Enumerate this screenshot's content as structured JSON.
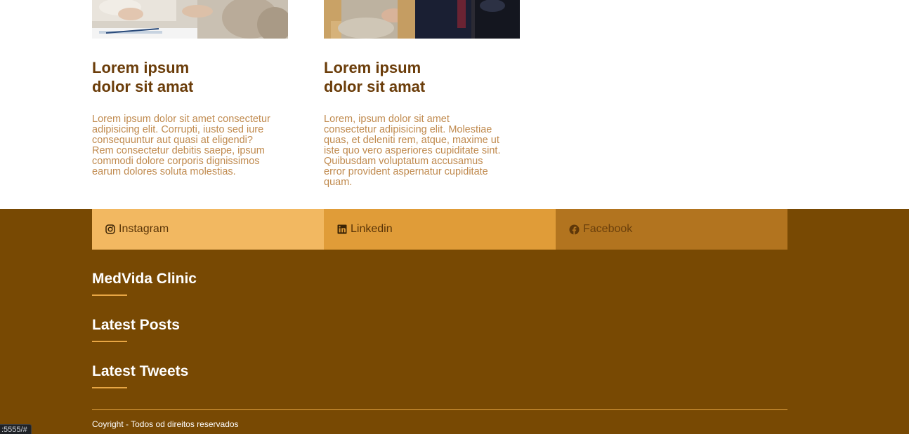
{
  "posts": [
    {
      "title_line1": "Lorem ipsum",
      "title_line2": "dolor sit amat",
      "text": "Lorem ipsum dolor sit amet consectetur adipisicing elit. Corrupti, iusto sed iure consequuntur aut quasi at eligendi? Rem consectetur debitis saepe, ipsum commodi dolore corporis dignissimos earum dolores soluta molestias."
    },
    {
      "title_line1": "Lorem ipsum",
      "title_line2": "dolor sit amat",
      "text": "Lorem, ipsum dolor sit amet consectetur adipisicing elit. Molestiae quas, et deleniti rem, atque, maxime ut iste quo vero asperiores cupiditate sint. Quibusdam voluptatum accusamus error provident aspernatur cupiditate quam."
    }
  ],
  "social": [
    {
      "label": "Instagram",
      "icon": "instagram-icon",
      "color": "#f2b861"
    },
    {
      "label": "Linkedin",
      "icon": "linkedin-icon",
      "color": "#e09c38"
    },
    {
      "label": "Facebook",
      "icon": "facebook-icon",
      "color": "#b2741f"
    }
  ],
  "footer": {
    "headings": [
      "MedVida Clinic",
      "Latest Posts",
      "Latest Tweets"
    ],
    "copyright": "Coyright - Todos od direitos reservados",
    "background": "#784903",
    "accent": "#e8a644"
  },
  "status_bar": {
    "url": ":5555/#"
  }
}
